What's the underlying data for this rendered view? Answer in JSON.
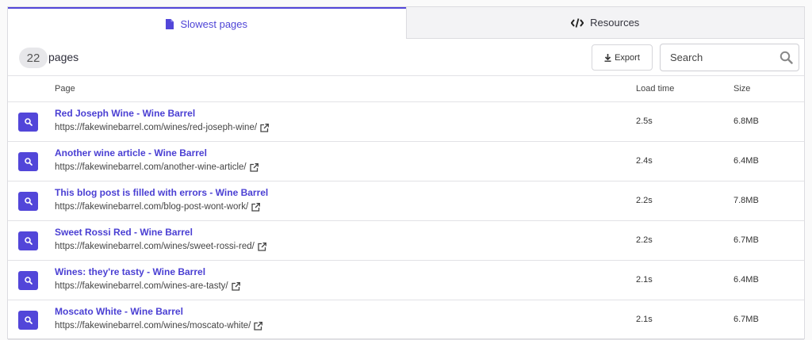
{
  "tabs": [
    {
      "label": "Slowest pages",
      "icon": "document-icon",
      "active": true
    },
    {
      "label": "Resources",
      "icon": "code-icon",
      "active": false
    }
  ],
  "toolbar": {
    "count": "22",
    "count_label": "pages",
    "export_label": "Export",
    "search_placeholder": "Search"
  },
  "table": {
    "columns": [
      "Page",
      "Load time",
      "Size"
    ],
    "rows": [
      {
        "title": "Red Joseph Wine - Wine Barrel",
        "url": "https://fakewinebarrel.com/wines/red-joseph-wine/",
        "load_time": "2.5s",
        "size": "6.8MB"
      },
      {
        "title": "Another wine article - Wine Barrel",
        "url": "https://fakewinebarrel.com/another-wine-article/",
        "load_time": "2.4s",
        "size": "6.4MB"
      },
      {
        "title": "This blog post is filled with errors - Wine Barrel",
        "url": "https://fakewinebarrel.com/blog-post-wont-work/",
        "load_time": "2.2s",
        "size": "7.8MB"
      },
      {
        "title": "Sweet Rossi Red - Wine Barrel",
        "url": "https://fakewinebarrel.com/wines/sweet-rossi-red/",
        "load_time": "2.2s",
        "size": "6.7MB"
      },
      {
        "title": "Wines: they're tasty - Wine Barrel",
        "url": "https://fakewinebarrel.com/wines-are-tasty/",
        "load_time": "2.1s",
        "size": "6.4MB"
      },
      {
        "title": "Moscato White - Wine Barrel",
        "url": "https://fakewinebarrel.com/wines/moscato-white/",
        "load_time": "2.1s",
        "size": "6.7MB"
      }
    ]
  },
  "colors": {
    "accent": "#5246d9",
    "link": "#4a3fd3"
  }
}
